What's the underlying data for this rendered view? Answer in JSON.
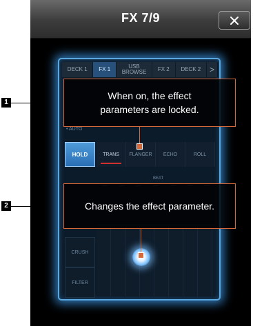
{
  "header": {
    "title": "FX 7/9",
    "close_icon": "close-icon"
  },
  "deck_tabs": [
    "DECK 1",
    "FX 1",
    "USB\nBROWSE",
    "FX 2",
    "DECK 2",
    ">"
  ],
  "active_tab": "FX 1",
  "controls": {
    "auto_label": "• AUTO",
    "hold_label": "HOLD",
    "fx_types": [
      "TRANS",
      "FLANGER",
      "ECHO",
      "ROLL"
    ],
    "selected_fx": "TRANS",
    "beat_label": "BEAT",
    "side_buttons": [
      "CRUSH",
      "FILTER"
    ]
  },
  "callouts": [
    {
      "number": "1",
      "text": "When on, the effect\nparameters are locked."
    },
    {
      "number": "2",
      "text": "Changes the effect parameter."
    }
  ],
  "colors": {
    "accent": "#5aa8e0",
    "callout_border": "#d46a3a",
    "hold_bg": "#2a6fb5"
  }
}
